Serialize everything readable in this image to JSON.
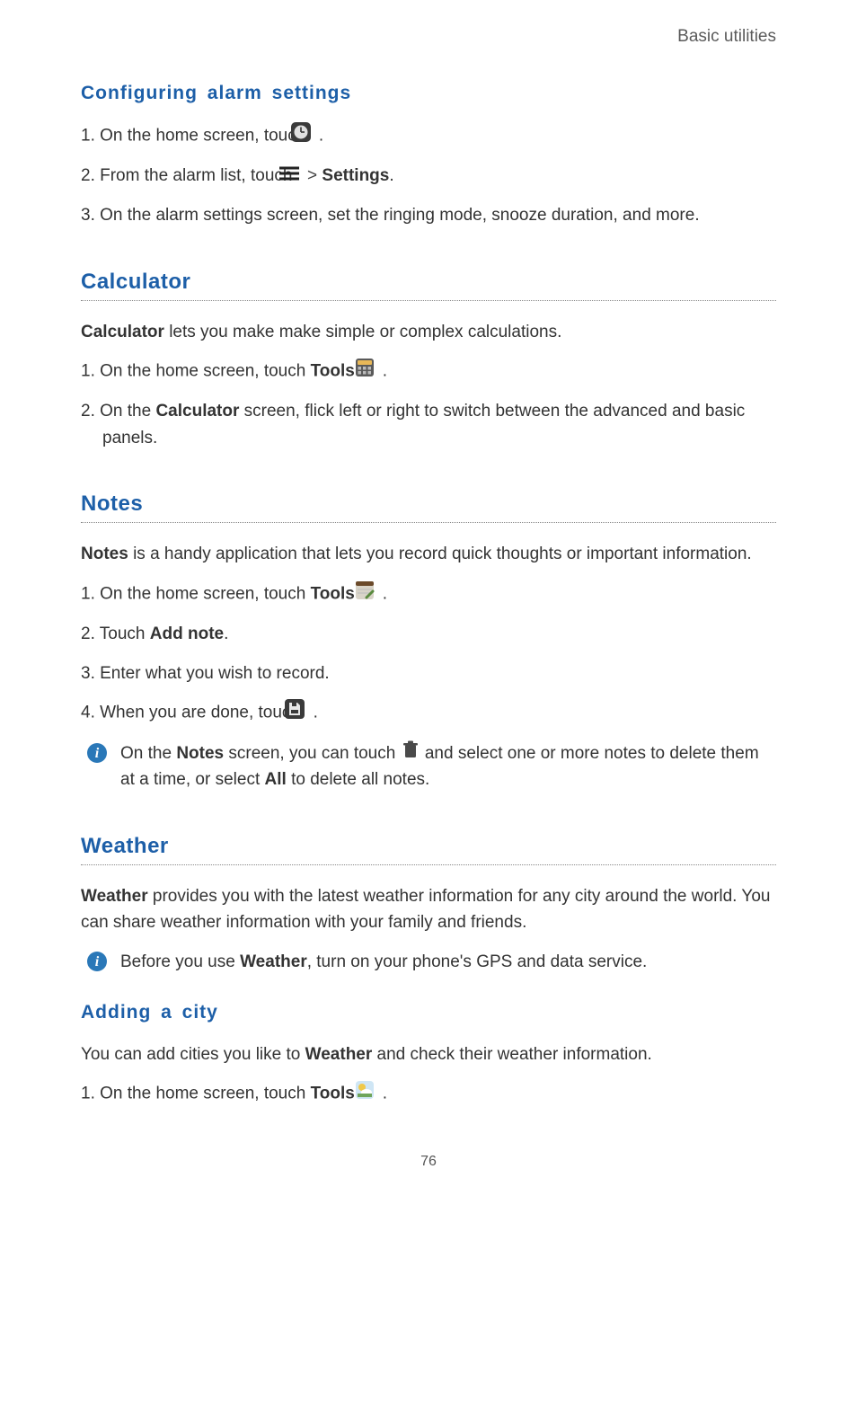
{
  "header": "Basic utilities",
  "alarm": {
    "heading": "Configuring  alarm  settings",
    "step1_a": "1. On the home screen, touch ",
    "step1_b": " .",
    "step2_a": "2.  From the alarm list, touch ",
    "step2_gt": " > ",
    "step2_settings": "Settings",
    "step2_end": ".",
    "step3": "3.  On the alarm settings screen, set the ringing mode, snooze duration, and more."
  },
  "calculator": {
    "heading": "Calculator",
    "intro_bold": "Calculator",
    "intro_rest": " lets you make make simple or complex calculations.",
    "step1_a": "1. On the home screen, touch ",
    "step1_tools": "Tools",
    "step1_gt": " > ",
    "step1_end": " .",
    "step2_a": "2.  On the ",
    "step2_calc": "Calculator",
    "step2_b": " screen, flick left or right to switch between the advanced and basic panels."
  },
  "notes": {
    "heading": "Notes",
    "intro_bold": "Notes",
    "intro_rest": " is a handy application that lets you record quick thoughts or important information.",
    "step1_a": "1. On the home screen, touch ",
    "step1_tools": "Tools",
    "step1_gt": " > ",
    "step1_end": " .",
    "step2_a": "2.  Touch ",
    "step2_add": "Add note",
    "step2_end": ".",
    "step3": "3.  Enter what you wish to record.",
    "step4_a": "4.  When you are done, touch ",
    "step4_end": " .",
    "info_a": "On the ",
    "info_notes": "Notes",
    "info_b": " screen, you can touch ",
    "info_c": " and select one or more notes to delete them at a time, or select ",
    "info_all": "All",
    "info_d": " to delete all notes."
  },
  "weather": {
    "heading": "Weather",
    "intro_bold": "Weather",
    "intro_rest": " provides you with the latest weather information for any city around the world. You can share weather information with your family and friends.",
    "info_a": "Before you use ",
    "info_w": "Weather",
    "info_b": ", turn on your phone's GPS and data service.",
    "add_heading": "Adding  a  city",
    "add_intro_a": "You can add cities you like to ",
    "add_intro_w": "Weather",
    "add_intro_b": " and check their weather information.",
    "step1_a": "1. On the home screen, touch ",
    "step1_tools": "Tools",
    "step1_gt": " > ",
    "step1_end": " ."
  },
  "page_number": "76"
}
